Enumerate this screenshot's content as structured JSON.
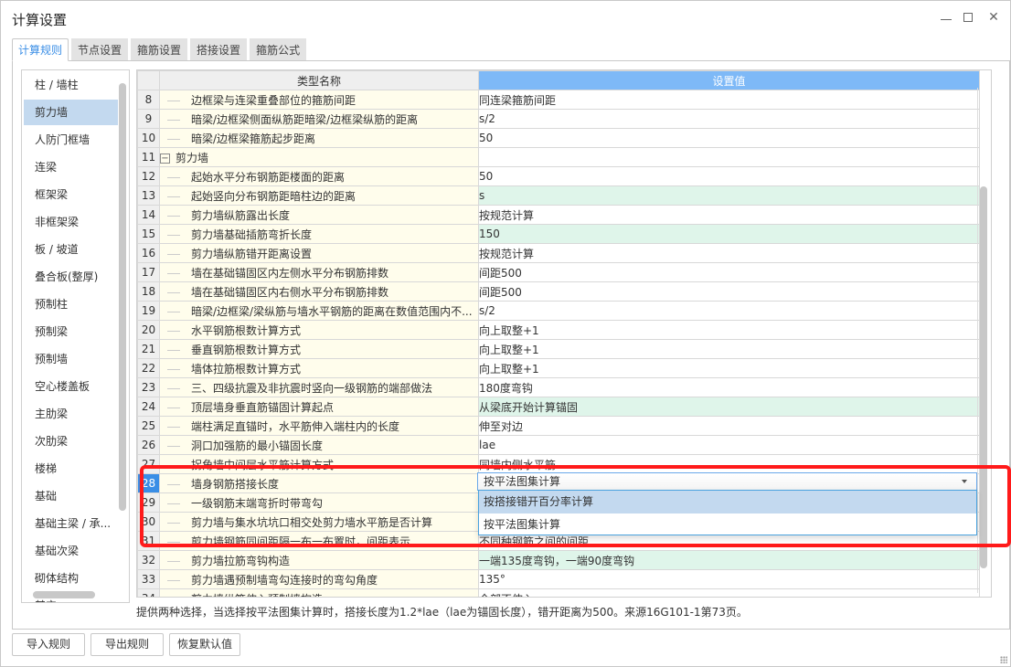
{
  "window": {
    "title": "计算设置",
    "minimize_icon": "minimize-icon",
    "maximize_icon": "maximize-icon",
    "close_icon": "close-icon"
  },
  "tabs": [
    {
      "label": "计算规则",
      "active": true
    },
    {
      "label": "节点设置",
      "active": false
    },
    {
      "label": "箍筋设置",
      "active": false
    },
    {
      "label": "搭接设置",
      "active": false
    },
    {
      "label": "箍筋公式",
      "active": false
    }
  ],
  "sidebar": {
    "selected": "剪力墙",
    "items": [
      "柱 / 墙柱",
      "剪力墙",
      "人防门框墙",
      "连梁",
      "框架梁",
      "非框架梁",
      "板 / 坡道",
      "叠合板(整厚)",
      "预制柱",
      "预制梁",
      "预制墙",
      "空心楼盖板",
      "主肋梁",
      "次肋梁",
      "楼梯",
      "基础",
      "基础主梁 / 承...",
      "基础次梁",
      "砌体结构",
      "其它"
    ]
  },
  "grid": {
    "columns": {
      "num": "",
      "name": "类型名称",
      "value": "设置值"
    },
    "rows": [
      {
        "num": "8",
        "name": "边框梁与连梁重叠部位的箍筋间距",
        "value": "同连梁箍筋间距",
        "green": false
      },
      {
        "num": "9",
        "name": "暗梁/边框梁侧面纵筋距暗梁/边框梁纵筋的距离",
        "value": "s/2",
        "green": false
      },
      {
        "num": "10",
        "name": "暗梁/边框梁箍筋起步距离",
        "value": "50",
        "green": false
      },
      {
        "num": "11",
        "name": "剪力墙",
        "value": "",
        "green": false,
        "group": true,
        "expander": "−"
      },
      {
        "num": "12",
        "name": "起始水平分布钢筋距楼面的距离",
        "value": "50",
        "green": false
      },
      {
        "num": "13",
        "name": "起始竖向分布钢筋距暗柱边的距离",
        "value": "s",
        "green": true
      },
      {
        "num": "14",
        "name": "剪力墙纵筋露出长度",
        "value": "按规范计算",
        "green": false
      },
      {
        "num": "15",
        "name": "剪力墙基础插筋弯折长度",
        "value": "150",
        "green": true
      },
      {
        "num": "16",
        "name": "剪力墙纵筋错开距离设置",
        "value": "按规范计算",
        "green": false
      },
      {
        "num": "17",
        "name": "墙在基础锚固区内左侧水平分布钢筋排数",
        "value": "间距500",
        "green": false
      },
      {
        "num": "18",
        "name": "墙在基础锚固区内右侧水平分布钢筋排数",
        "value": "间距500",
        "green": false
      },
      {
        "num": "19",
        "name": "暗梁/边框梁/梁纵筋与墙水平钢筋的距离在数值范围内不...",
        "value": "s/2",
        "green": false
      },
      {
        "num": "20",
        "name": "水平钢筋根数计算方式",
        "value": "向上取整+1",
        "green": false
      },
      {
        "num": "21",
        "name": "垂直钢筋根数计算方式",
        "value": "向上取整+1",
        "green": false
      },
      {
        "num": "22",
        "name": "墙体拉筋根数计算方式",
        "value": "向上取整+1",
        "green": false
      },
      {
        "num": "23",
        "name": "三、四级抗震及非抗震时竖向一级钢筋的端部做法",
        "value": "180度弯钩",
        "green": false
      },
      {
        "num": "24",
        "name": "顶层墙身垂直筋锚固计算起点",
        "value": "从梁底开始计算锚固",
        "green": true
      },
      {
        "num": "25",
        "name": "端柱满足直锚时，水平筋伸入端柱内的长度",
        "value": "伸至对边",
        "green": false
      },
      {
        "num": "26",
        "name": "洞口加强筋的最小锚固长度",
        "value": "lae",
        "green": false
      },
      {
        "num": "27",
        "name": "拐角墙中间层水平筋计算方式",
        "value": "同墙内侧水平筋",
        "green": false
      },
      {
        "num": "28",
        "name": "墙身钢筋搭接长度",
        "value": "按平法图集计算",
        "green": false,
        "selected": true
      },
      {
        "num": "29",
        "name": "一级钢筋末端弯折时带弯勾",
        "value": "",
        "green": false
      },
      {
        "num": "30",
        "name": "剪力墙与集水坑坑口相交处剪力墙水平筋是否计算",
        "value": "",
        "green": false
      },
      {
        "num": "31",
        "name": "剪力墙钢筋同间距隔一布一布置时，间距表示",
        "value": "不同种钢筋之间的间距",
        "green": false
      },
      {
        "num": "32",
        "name": "剪力墙拉筋弯钩构造",
        "value": "一端135度弯钩，一端90度弯钩",
        "green": true
      },
      {
        "num": "33",
        "name": "剪力墙遇预制墙弯勾连接时的弯勾角度",
        "value": "135°",
        "green": false
      },
      {
        "num": "34",
        "name": "剪力墙纵筋伸入预制墙构造",
        "value": "全部不伸入",
        "green": false
      }
    ]
  },
  "dropdown": {
    "current": "按平法图集计算",
    "options": [
      {
        "label": "按搭接错开百分率计算",
        "hover": true
      },
      {
        "label": "按平法图集计算",
        "hover": false
      }
    ]
  },
  "hint": "提供两种选择，当选择按平法图集计算时，搭接长度为1.2*lae（lae为锚固长度），错开距离为500。来源16G101-1第73页。",
  "buttons": {
    "import": "导入规则",
    "export": "导出规则",
    "restore": "恢复默认值"
  },
  "colors": {
    "accent": "#3a8ee6",
    "header_value_bg": "#7eb9f7",
    "name_cell_bg": "#fffdec",
    "modified_value_bg": "#dff5ea",
    "sidebar_selected": "#c3d9ef",
    "highlight_annotation": "#ff1a1a"
  }
}
